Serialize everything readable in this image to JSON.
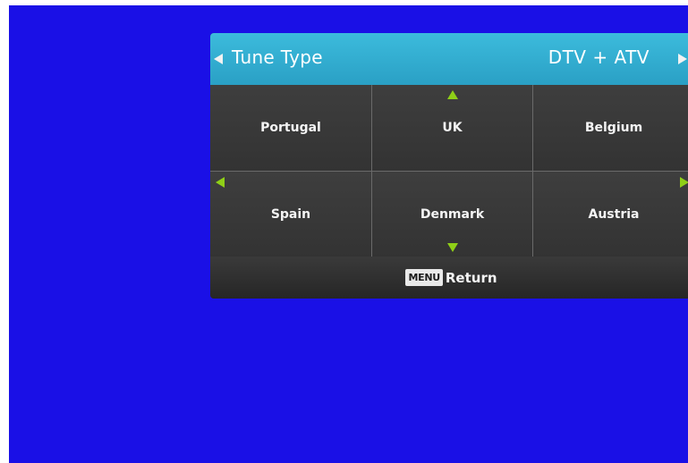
{
  "tune_type": {
    "label": "Tune Type",
    "value": "DTV + ATV"
  },
  "countries": [
    "Portugal",
    "UK",
    "Belgium",
    "Spain",
    "Denmark",
    "Austria"
  ],
  "footer": {
    "key_label": "MENU",
    "action_label": "Return"
  },
  "colors": {
    "background": "#1a10e6",
    "tune_bar": "#2fa9cf",
    "arrow_accent": "#8fcf17",
    "panel": "#333333"
  }
}
